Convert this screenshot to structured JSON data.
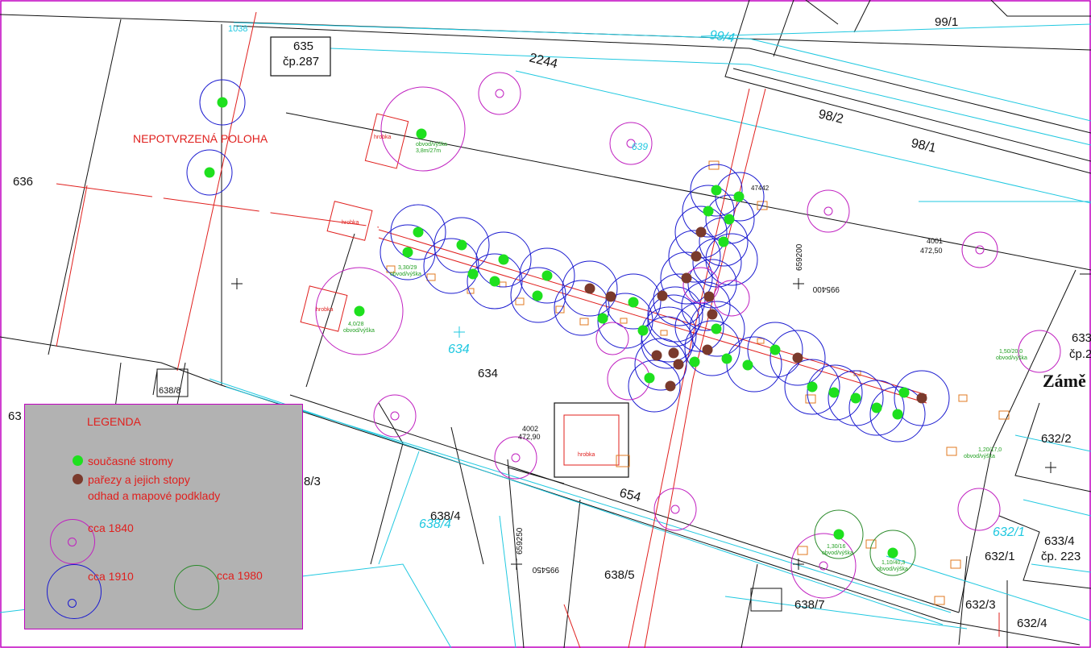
{
  "map": {
    "parcels": {
      "p635": "635",
      "p635_cp": "čp.287",
      "p99_1": "99/1",
      "p99_4": "99/4",
      "p98_2": "98/2",
      "p98_1": "98/1",
      "road_2244": "2244",
      "p636": "636",
      "p634": "634",
      "p634_cyan": "634",
      "p638_8": "638/8",
      "p63": "63",
      "p8_3": "8/3",
      "p638_4": "638/4",
      "p638_4_cyan": "638/4",
      "p654": "654",
      "p638_5": "638/5",
      "p638_7": "638/7",
      "p632_1": "632/1",
      "p632_1_cyan": "632/1",
      "p632_2": "632/2",
      "p632_3": "632/3",
      "p632_4": "632/4",
      "p633_4": "633/4",
      "p633_4_cp": "čp. 223",
      "p633_right": "633",
      "p633_right_cp": "čp.2",
      "zamek": "Zámě",
      "p1038": "1038",
      "p639": "639"
    },
    "unconfirmed_label": "NEPOTVRZENÁ POLOHA",
    "coords": {
      "c659200": "659200",
      "c995400": "995400",
      "c659250": "659250",
      "c995450": "995450",
      "h4001": "4001",
      "h4001_v": "472,50",
      "h4002": "4002",
      "h4002_v": "472,90",
      "h47442": "47442"
    },
    "tree_labels": {
      "t_top": "obvod/výška",
      "t_top_v": "3,8m/27m",
      "t_left": "obvod/výška",
      "t_left_v": "4,0/28",
      "t_row_a": "3,30/29",
      "t_row_a2": "obvod/výška",
      "t_right": "obvod/výška",
      "t_right_v": "1,50/20,0",
      "t_bottom_a": "1,30/16",
      "t_bottom_a2": "obvod/výška",
      "t_bottom_b": "1,10/40,3",
      "t_bottom_b2": "obvod/výška",
      "t_right2": "1,20/17,0",
      "t_right2b": "obvod/výška",
      "hrobka": "hrobka"
    }
  },
  "legend": {
    "title": "LEGENDA",
    "current_trees": "současné stromy",
    "stumps_line1": "pařezy a jejich stopy",
    "stumps_line2": "odhad a mapové podklady",
    "era_1840": "cca 1840",
    "era_1910": "cca 1910",
    "era_1980": "cca 1980",
    "colors": {
      "current_tree": "#1ee01e",
      "stump": "#7a3a2c",
      "ring_1840": "#c020c0",
      "ring_1910": "#1a1ad0",
      "ring_1980": "#2a8a2a",
      "label_red": "#e0201e",
      "cadastre_cyan": "#20c8e0"
    }
  }
}
